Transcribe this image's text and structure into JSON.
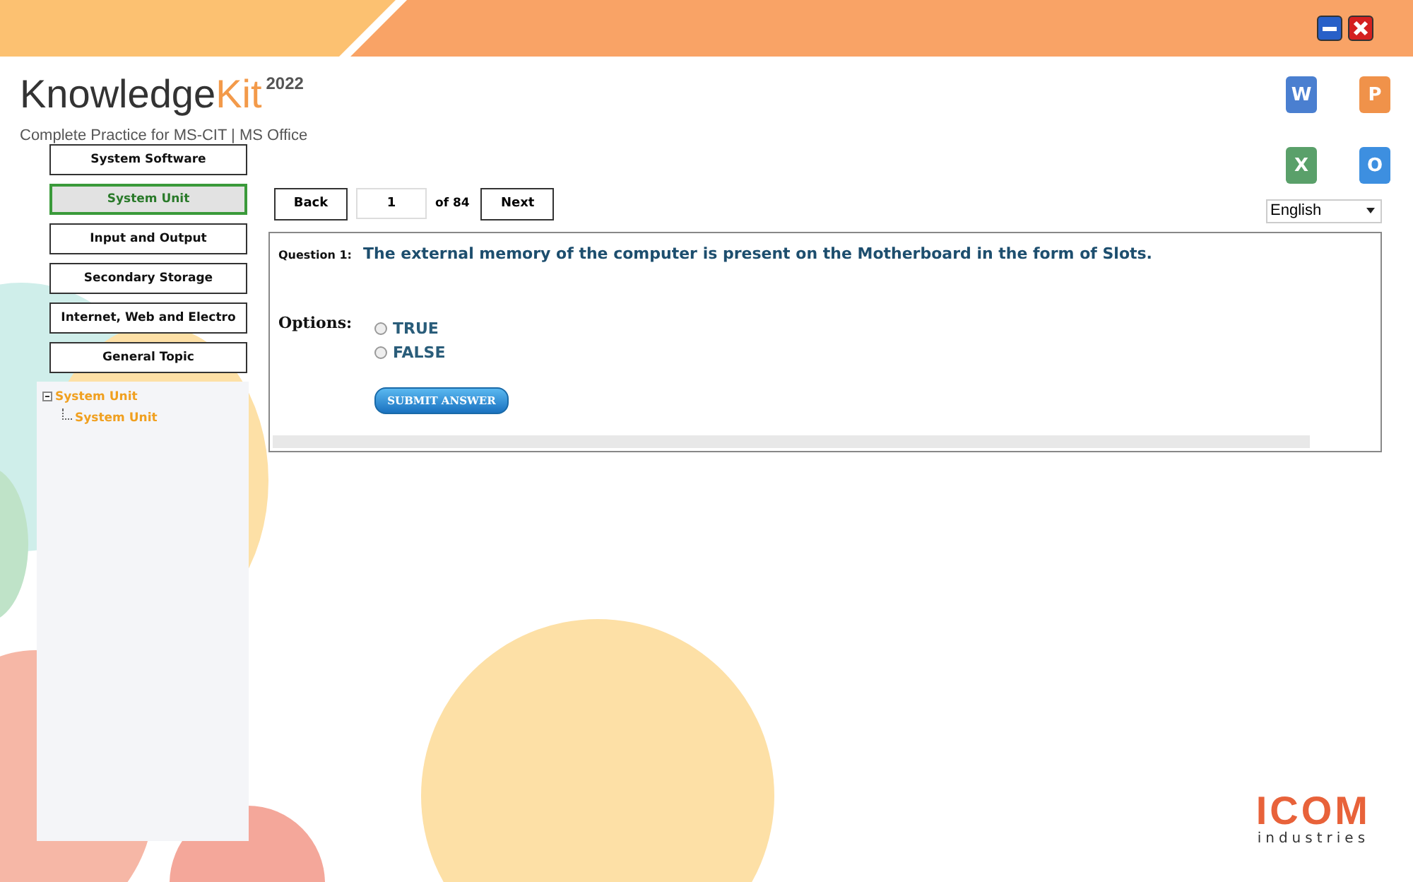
{
  "window": {
    "controls": [
      {
        "kind": "minimize"
      },
      {
        "kind": "close"
      }
    ]
  },
  "brand": {
    "name_main": "Knowledge",
    "name_accent": "Kit",
    "edition": "2022",
    "tagline": "Complete Practice for MS-CIT | MS Office"
  },
  "apps": [
    {
      "letter": "W",
      "color": "#4a7fd0"
    },
    {
      "letter": "P",
      "color": "#f0924a"
    },
    {
      "letter": "X",
      "color": "#5aa06a"
    },
    {
      "letter": "O",
      "color": "#3d8fe0"
    }
  ],
  "topics": [
    {
      "label": "System Software",
      "selected": false
    },
    {
      "label": "System Unit",
      "selected": true
    },
    {
      "label": "Input and Output",
      "selected": false
    },
    {
      "label": "Secondary Storage",
      "selected": false
    },
    {
      "label": "Internet, Web and Electro",
      "selected": false
    },
    {
      "label": "General Topic",
      "selected": false
    }
  ],
  "tree": [
    {
      "label": "System Unit",
      "expanded": true,
      "children": [
        {
          "label": "System Unit"
        }
      ]
    }
  ],
  "nav": {
    "back": "Back",
    "page": "1",
    "total": "of 84",
    "next": "Next"
  },
  "language": {
    "value": "English"
  },
  "question": {
    "label": "Question 1:",
    "text": "The external memory of the computer is present on the Motherboard in the form of Slots.",
    "options_label": "Options:",
    "options": [
      {
        "label": "TRUE",
        "selected": false
      },
      {
        "label": "FALSE",
        "selected": false
      }
    ],
    "submit": "SUBMIT ANSWER"
  },
  "company": {
    "name": "ICOM",
    "tagline": "industries"
  }
}
